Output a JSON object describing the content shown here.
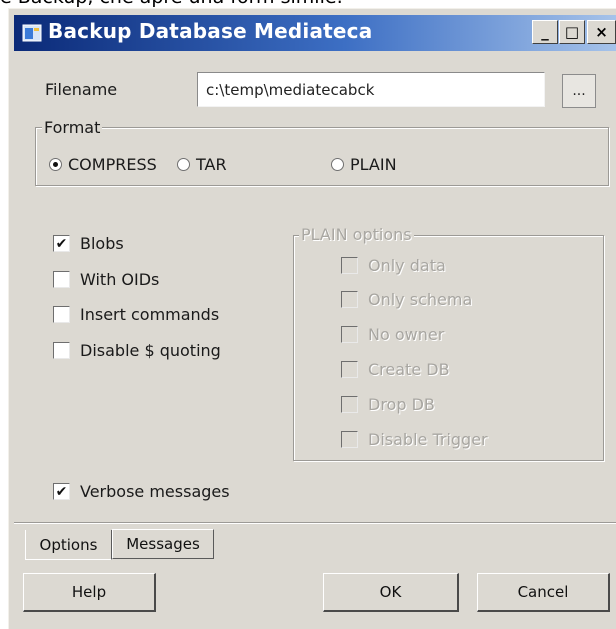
{
  "caption": "e Backup, che apre una form simile:",
  "window": {
    "title": "Backup Database Mediateca",
    "minimize_label": "_",
    "maximize_label": "□",
    "close_label": "×"
  },
  "filename": {
    "label": "Filename",
    "value": "c:\\temp\\mediatecabck",
    "browse_label": "..."
  },
  "format": {
    "legend": "Format",
    "options": [
      "COMPRESS",
      "TAR",
      "PLAIN"
    ],
    "selected": "COMPRESS"
  },
  "options": {
    "blobs": {
      "label": "Blobs",
      "checked": true
    },
    "with_oids": {
      "label": "With OIDs",
      "checked": false
    },
    "insert_commands": {
      "label": "Insert commands",
      "checked": false
    },
    "disable_quoting": {
      "label": "Disable $ quoting",
      "checked": false
    },
    "verbose": {
      "label": "Verbose messages",
      "checked": true
    }
  },
  "plain_options": {
    "legend": "PLAIN options",
    "items": [
      "Only data",
      "Only schema",
      "No owner",
      "Create DB",
      "Drop DB",
      "Disable Trigger"
    ]
  },
  "tabs": [
    "Options",
    "Messages"
  ],
  "buttons": {
    "help": "Help",
    "ok": "OK",
    "cancel": "Cancel"
  },
  "check_glyph": "✔"
}
